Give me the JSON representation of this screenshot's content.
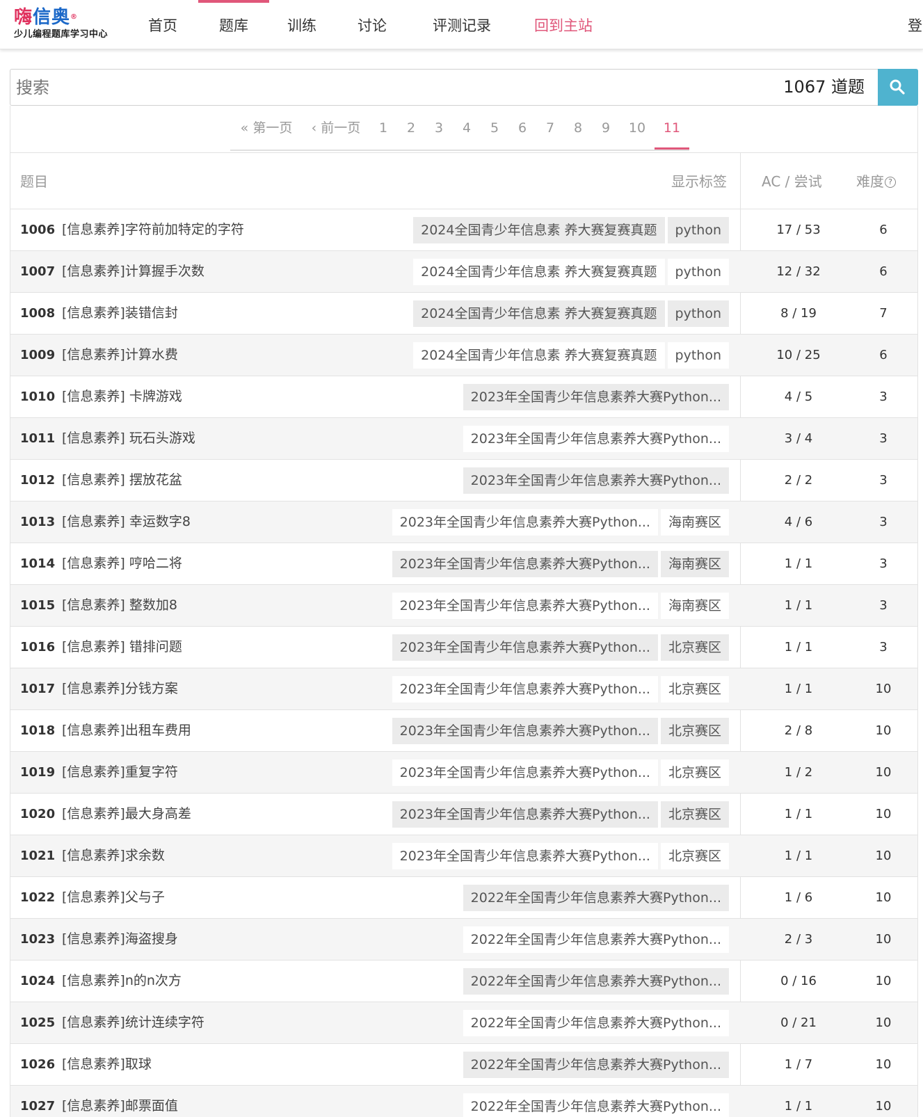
{
  "logo": {
    "main_1": "嗨",
    "main_2": "信奥",
    "reg": "®",
    "sub": "少儿编程题库学习中心"
  },
  "nav": {
    "items": [
      "首页",
      "题库",
      "训练",
      "讨论",
      "评测记录",
      "回到主站"
    ],
    "active": "题库",
    "login": "登"
  },
  "search": {
    "placeholder": "搜索",
    "count": "1067 道题",
    "button_icon": "search-icon"
  },
  "pagination": {
    "first": "« 第一页",
    "prev": "‹ 前一页",
    "pages": [
      "1",
      "2",
      "3",
      "4",
      "5",
      "6",
      "7",
      "8",
      "9",
      "10",
      "11"
    ],
    "current": "11"
  },
  "table": {
    "headers": {
      "title": "题目",
      "show_tags": "显示标签",
      "ac": "AC / 尝试",
      "difficulty": "难度"
    },
    "rows": [
      {
        "id": "1006",
        "title": "[信息素养]字符前加特定的字符",
        "tags": [
          "2024全国青少年信息素 养大赛复赛真题",
          "python"
        ],
        "ac": "17 / 53",
        "diff": "6"
      },
      {
        "id": "1007",
        "title": "[信息素养]计算握手次数",
        "tags": [
          "2024全国青少年信息素 养大赛复赛真题",
          "python"
        ],
        "ac": "12 / 32",
        "diff": "6"
      },
      {
        "id": "1008",
        "title": "[信息素养]装错信封",
        "tags": [
          "2024全国青少年信息素 养大赛复赛真题",
          "python"
        ],
        "ac": "8 / 19",
        "diff": "7"
      },
      {
        "id": "1009",
        "title": "[信息素养]计算水费",
        "tags": [
          "2024全国青少年信息素 养大赛复赛真题",
          "python"
        ],
        "ac": "10 / 25",
        "diff": "6"
      },
      {
        "id": "1010",
        "title": " [信息素养] 卡牌游戏",
        "tags": [
          "2023年全国青少年信息素养大赛Python..."
        ],
        "ac": "4 / 5",
        "diff": "3"
      },
      {
        "id": "1011",
        "title": " [信息素养] 玩石头游戏",
        "tags": [
          "2023年全国青少年信息素养大赛Python..."
        ],
        "ac": "3 / 4",
        "diff": "3"
      },
      {
        "id": "1012",
        "title": " [信息素养] 摆放花盆",
        "tags": [
          "2023年全国青少年信息素养大赛Python..."
        ],
        "ac": "2 / 2",
        "diff": "3"
      },
      {
        "id": "1013",
        "title": " [信息素养] 幸运数字8",
        "tags": [
          "2023年全国青少年信息素养大赛Python...",
          "海南赛区"
        ],
        "ac": "4 / 6",
        "diff": "3"
      },
      {
        "id": "1014",
        "title": " [信息素养] 哼哈二将",
        "tags": [
          "2023年全国青少年信息素养大赛Python...",
          "海南赛区"
        ],
        "ac": "1 / 1",
        "diff": "3"
      },
      {
        "id": "1015",
        "title": " [信息素养] 整数加8",
        "tags": [
          "2023年全国青少年信息素养大赛Python...",
          "海南赛区"
        ],
        "ac": "1 / 1",
        "diff": "3"
      },
      {
        "id": "1016",
        "title": " [信息素养] 错排问题",
        "tags": [
          "2023年全国青少年信息素养大赛Python...",
          "北京赛区"
        ],
        "ac": "1 / 1",
        "diff": "3"
      },
      {
        "id": "1017",
        "title": "[信息素养]分钱方案",
        "tags": [
          "2023年全国青少年信息素养大赛Python...",
          "北京赛区"
        ],
        "ac": "1 / 1",
        "diff": "10"
      },
      {
        "id": "1018",
        "title": "[信息素养]出租车费用",
        "tags": [
          "2023年全国青少年信息素养大赛Python...",
          "北京赛区"
        ],
        "ac": "2 / 8",
        "diff": "10"
      },
      {
        "id": "1019",
        "title": "[信息素养]重复字符",
        "tags": [
          "2023年全国青少年信息素养大赛Python...",
          "北京赛区"
        ],
        "ac": "1 / 2",
        "diff": "10"
      },
      {
        "id": "1020",
        "title": "[信息素养]最大身高差",
        "tags": [
          "2023年全国青少年信息素养大赛Python...",
          "北京赛区"
        ],
        "ac": "1 / 1",
        "diff": "10"
      },
      {
        "id": "1021",
        "title": "[信息素养]求余数",
        "tags": [
          "2023年全国青少年信息素养大赛Python...",
          "北京赛区"
        ],
        "ac": "1 / 1",
        "diff": "10"
      },
      {
        "id": "1022",
        "title": "[信息素养]父与子",
        "tags": [
          "2022年全国青少年信息素养大赛Python..."
        ],
        "ac": "1 / 6",
        "diff": "10"
      },
      {
        "id": "1023",
        "title": "[信息素养]海盗搜身",
        "tags": [
          "2022年全国青少年信息素养大赛Python..."
        ],
        "ac": "2 / 3",
        "diff": "10"
      },
      {
        "id": "1024",
        "title": "[信息素养]n的n次方",
        "tags": [
          "2022年全国青少年信息素养大赛Python..."
        ],
        "ac": "0 / 16",
        "diff": "10"
      },
      {
        "id": "1025",
        "title": "[信息素养]统计连续字符",
        "tags": [
          "2022年全国青少年信息素养大赛Python..."
        ],
        "ac": "0 / 21",
        "diff": "10"
      },
      {
        "id": "1026",
        "title": "[信息素养]取球",
        "tags": [
          "2022年全国青少年信息素养大赛Python..."
        ],
        "ac": "1 / 7",
        "diff": "10"
      },
      {
        "id": "1027",
        "title": "[信息素养]邮票面值",
        "tags": [
          "2022年全国青少年信息素养大赛Python..."
        ],
        "ac": "1 / 1",
        "diff": "10"
      }
    ]
  },
  "colors": {
    "brand_pink": "#e0577a",
    "brand_blue": "#1b68c8",
    "search_button": "#4fb3cf"
  }
}
